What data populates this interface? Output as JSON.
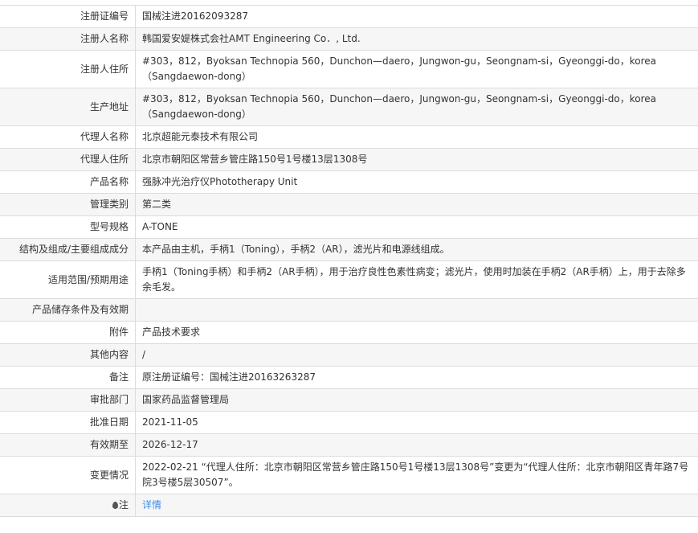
{
  "rows": [
    {
      "label": "注册证编号",
      "value": "国械注进20162093287"
    },
    {
      "label": "注册人名称",
      "value": "韩国爱安媞株式会社AMT Engineering Co．, Ltd."
    },
    {
      "label": "注册人住所",
      "value": "#303，812，Byoksan Technopia 560，Dunchon—daero，Jungwon-gu，Seongnam-si，Gyeonggi-do，korea（Sangdaewon-dong）"
    },
    {
      "label": "生产地址",
      "value": "#303，812，Byoksan Technopia 560，Dunchon—daero，Jungwon-gu，Seongnam-si，Gyeonggi-do，korea（Sangdaewon-dong）"
    },
    {
      "label": "代理人名称",
      "value": "北京超能元泰技术有限公司"
    },
    {
      "label": "代理人住所",
      "value": "北京市朝阳区常营乡管庄路150号1号楼13层1308号"
    },
    {
      "label": "产品名称",
      "value": "强脉冲光治疗仪Phototherapy Unit"
    },
    {
      "label": "管理类别",
      "value": "第二类"
    },
    {
      "label": "型号规格",
      "value": "A-TONE"
    },
    {
      "label": "结构及组成/主要组成成分",
      "value": "本产品由主机，手柄1（Toning），手柄2（AR），滤光片和电源线组成。"
    },
    {
      "label": "适用范围/预期用途",
      "value": "手柄1（Toning手柄）和手柄2（AR手柄），用于治疗良性色素性病变；滤光片，使用时加装在手柄2（AR手柄）上，用于去除多余毛发。"
    },
    {
      "label": "产品储存条件及有效期",
      "value": ""
    },
    {
      "label": "附件",
      "value": "产品技术要求"
    },
    {
      "label": "其他内容",
      "value": "/"
    },
    {
      "label": "备注",
      "value": "原注册证编号：国械注进20163263287"
    },
    {
      "label": "审批部门",
      "value": "国家药品监督管理局"
    },
    {
      "label": "批准日期",
      "value": "2021-11-05"
    },
    {
      "label": "有效期至",
      "value": "2026-12-17"
    },
    {
      "label": "变更情况",
      "value": "2022-02-21 “代理人住所：北京市朝阳区常营乡管庄路150号1号楼13层1308号”变更为“代理人住所：北京市朝阳区青年路7号院3号楼5层30507”。"
    }
  ],
  "note": {
    "label": "注",
    "link": "详情",
    "icon": "map-pin-icon"
  }
}
